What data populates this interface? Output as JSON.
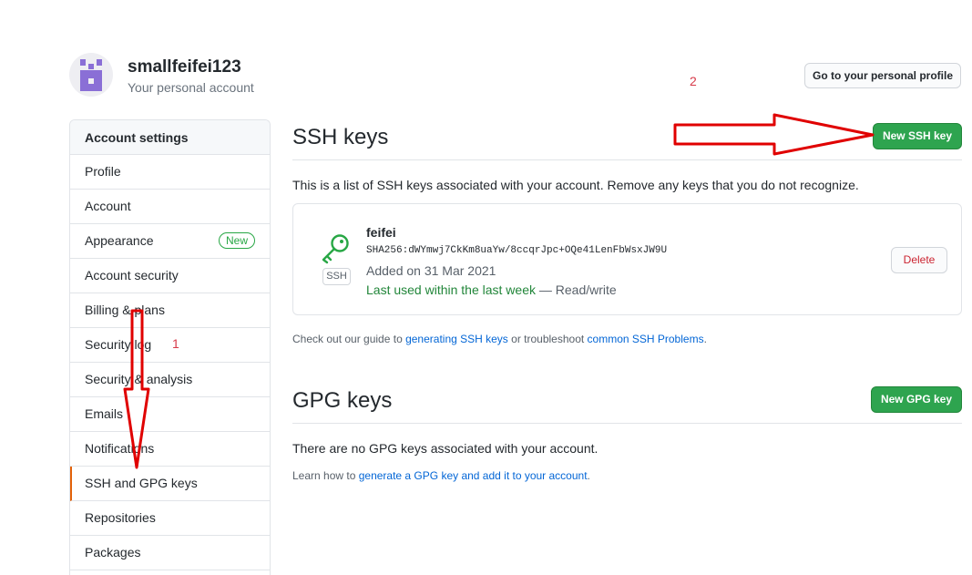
{
  "header": {
    "username": "smallfeifei123",
    "subtitle": "Your personal account",
    "profile_button": "Go to your personal profile"
  },
  "annotations": {
    "arrow_1_number": "1",
    "arrow_2_number": "2",
    "arrow_color": "#e00000"
  },
  "sidebar": {
    "heading": "Account settings",
    "items": [
      {
        "label": "Profile"
      },
      {
        "label": "Account"
      },
      {
        "label": "Appearance",
        "badge": "New"
      },
      {
        "label": "Account security"
      },
      {
        "label": "Billing & plans"
      },
      {
        "label": "Security log"
      },
      {
        "label": "Security & analysis"
      },
      {
        "label": "Emails"
      },
      {
        "label": "Notifications"
      },
      {
        "label": "SSH and GPG keys",
        "selected": true
      },
      {
        "label": "Repositories"
      },
      {
        "label": "Packages"
      }
    ]
  },
  "ssh": {
    "title": "SSH keys",
    "new_button": "New SSH key",
    "description": "This is a list of SSH keys associated with your account. Remove any keys that you do not recognize.",
    "key": {
      "title": "feifei",
      "fingerprint": "SHA256:dWYmwj7CkKm8uaYw/8ccqrJpc+OQe41LenFbWsxJW9U",
      "added": "Added on 31 Mar 2021",
      "last_used": "Last used within the last week",
      "access": " — Read/write",
      "tag": "SSH",
      "delete_button": "Delete",
      "icon": "key-icon"
    },
    "guide_prefix": "Check out our guide to ",
    "guide_link1": "generating SSH keys",
    "guide_middle": " or troubleshoot ",
    "guide_link2": "common SSH Problems",
    "guide_suffix": "."
  },
  "gpg": {
    "title": "GPG keys",
    "new_button": "New GPG key",
    "empty_text": "There are no GPG keys associated with your account.",
    "learn_prefix": "Learn how to ",
    "learn_link": "generate a GPG key and add it to your account",
    "learn_suffix": "."
  },
  "colors": {
    "green": "#2ea44f",
    "link": "#0366d6",
    "selected_border": "#e36209"
  }
}
